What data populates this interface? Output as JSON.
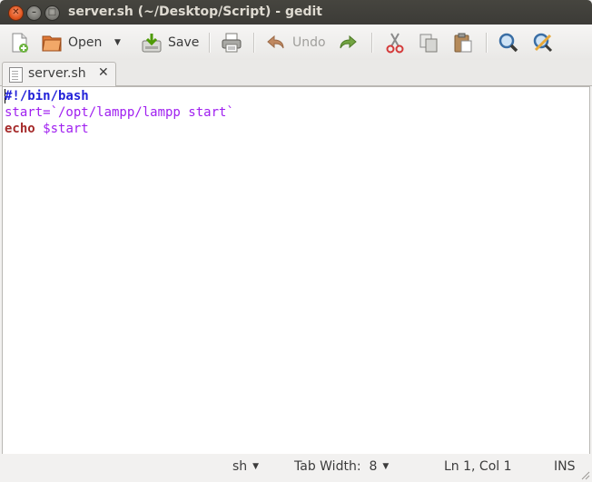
{
  "window": {
    "title": "server.sh (~/Desktop/Script) - gedit"
  },
  "toolbar": {
    "new_icon": "new-document-icon",
    "open_label": "Open",
    "save_label": "Save",
    "undo_label": "Undo",
    "print_icon": "print-icon",
    "redo_icon": "redo-icon",
    "cut_icon": "cut-icon",
    "copy_icon": "copy-icon",
    "paste_icon": "paste-icon",
    "find_icon": "find-icon",
    "replace_icon": "find-replace-icon"
  },
  "tabs": [
    {
      "label": "server.sh",
      "close": "✕"
    }
  ],
  "editor": {
    "lines": [
      {
        "segments": [
          {
            "text": "#!/bin/bash",
            "style": "kw-blue"
          }
        ]
      },
      {
        "segments": [
          {
            "text": "start=`/opt/lampp/lampp start`",
            "style": "purple"
          }
        ]
      },
      {
        "segments": [
          {
            "text": "echo",
            "style": "kw-red"
          },
          {
            "text": " ",
            "style": ""
          },
          {
            "text": "$start",
            "style": "purple"
          }
        ]
      }
    ]
  },
  "statusbar": {
    "language": "sh",
    "tab_width": "Tab Width:  8",
    "position": "Ln 1, Col 1",
    "mode": "INS"
  },
  "colors": {
    "titlebar": "#3c3b37",
    "close_button": "#e2561f",
    "keyword_blue": "#2323d9",
    "keyword_red": "#a52a2a",
    "string_purple": "#a020f0"
  }
}
